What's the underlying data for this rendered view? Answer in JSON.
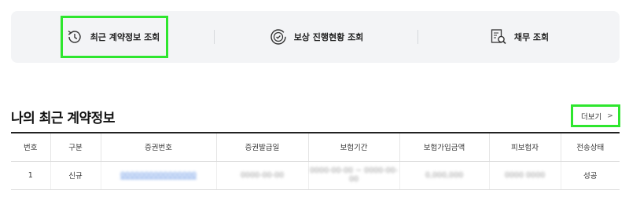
{
  "tabs": [
    {
      "label": "최근 계약정보 조회",
      "icon": "clock-history-icon"
    },
    {
      "label": "보상 진행현황 조회",
      "icon": "check-circle-icon"
    },
    {
      "label": "채무 조회",
      "icon": "document-search-icon"
    }
  ],
  "section": {
    "title": "나의 최근 계약정보",
    "more_label": "더보기",
    "more_chevron": ">"
  },
  "table": {
    "columns": [
      "번호",
      "구분",
      "증권번호",
      "증권발급일",
      "보험기간",
      "보험가입금액",
      "피보험자",
      "전송상태"
    ],
    "rows": [
      {
        "no": "1",
        "type": "신규",
        "policy_number": "0000000000000000",
        "issue_date": "0000-00-00",
        "period": "0000-00-00 ~ 0000-00-00",
        "amount": "0,000,000",
        "insured": "0000 0000",
        "status": "성공"
      }
    ]
  },
  "colors": {
    "highlight": "#2ee62e",
    "tabbar_bg": "#f3f4f6",
    "link": "#4a82e0"
  }
}
